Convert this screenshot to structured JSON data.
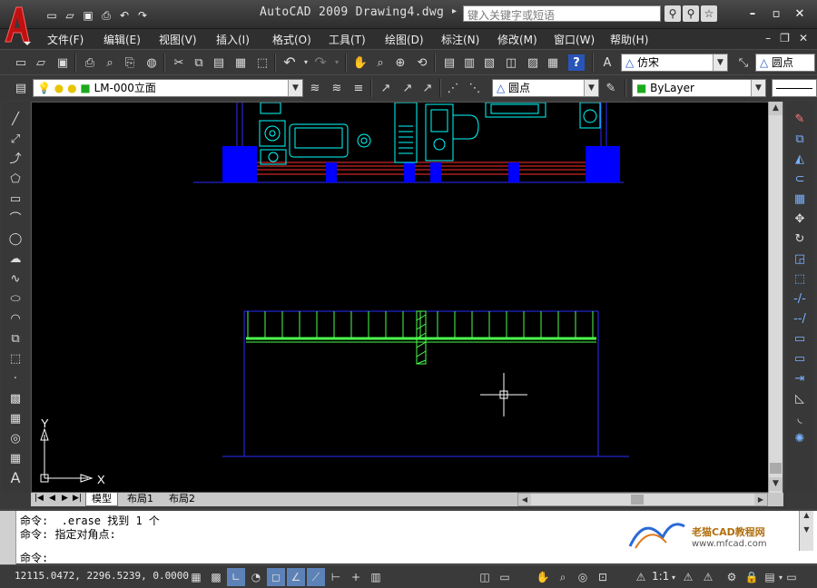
{
  "app": {
    "title": "AutoCAD 2009 Drawing4.dwg",
    "search_placeholder": "键入关键字或短语",
    "logo_letter": "A"
  },
  "menu": [
    "文件(F)",
    "编辑(E)",
    "视图(V)",
    "插入(I)",
    "格式(O)",
    "工具(T)",
    "绘图(D)",
    "标注(N)",
    "修改(M)",
    "窗口(W)",
    "帮助(H)"
  ],
  "toolbar": {
    "text_style": "仿宋",
    "dim_style": "圆点",
    "layer": "LM-000立面",
    "multileader_style": "圆点",
    "color": "ByLayer"
  },
  "canvas": {
    "background": "#000000",
    "ucs_y": "Y",
    "ucs_x": "X"
  },
  "tabs": [
    "模型",
    "布局1",
    "布局2"
  ],
  "command": {
    "history": [
      "命令:  .erase 找到 1 个",
      "命令: 指定对角点:"
    ],
    "prompt": "命令:"
  },
  "watermark": {
    "brand": "老猫CAD教程网",
    "url": "www.mfcad.com"
  },
  "status": {
    "coords": "12115.0472, 2296.5239, 0.0000",
    "scale": "1:1"
  },
  "colors": {
    "accent_blue": "#0000ff",
    "cyan": "#00ffff",
    "green": "#4cff4c",
    "red": "#ff2b2b",
    "logo_red": "#c01010"
  }
}
